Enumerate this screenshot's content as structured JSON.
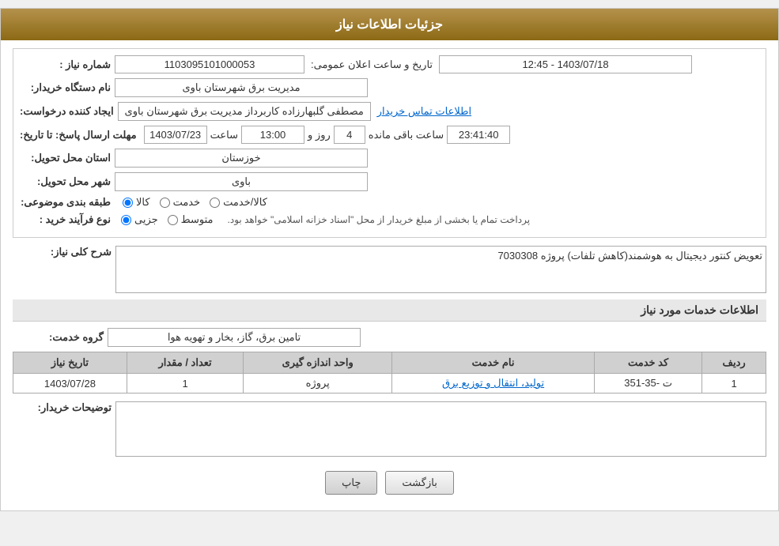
{
  "header": {
    "title": "جزئیات اطلاعات نیاز"
  },
  "fields": {
    "need_number_label": "شماره نیاز :",
    "need_number_value": "1103095101000053",
    "announce_date_label": "تاریخ و ساعت اعلان عمومی:",
    "announce_date_value": "1403/07/18 - 12:45",
    "buyer_org_label": "نام دستگاه خریدار:",
    "buyer_org_value": "مدیریت برق شهرستان باوی",
    "requester_label": "ایجاد کننده درخواست:",
    "requester_value": "مصطفی گلبهارزاده کاربرداز مدیریت برق شهرستان باوی",
    "contact_link": "اطلاعات تماس خریدار",
    "deadline_label": "مهلت ارسال پاسخ: تا تاریخ:",
    "deadline_date": "1403/07/23",
    "deadline_time_label": "ساعت",
    "deadline_time": "13:00",
    "deadline_days_label": "روز و",
    "deadline_days": "4",
    "deadline_remaining_label": "ساعت باقی مانده",
    "deadline_remaining": "23:41:40",
    "province_label": "استان محل تحویل:",
    "province_value": "خوزستان",
    "city_label": "شهر محل تحویل:",
    "city_value": "باوی",
    "category_label": "طبقه بندی موضوعی:",
    "category_goods": "کالا",
    "category_service": "خدمت",
    "category_goods_service": "کالا/خدمت",
    "purchase_type_label": "نوع فرآیند خرید :",
    "purchase_type_partial": "جزیی",
    "purchase_type_medium": "متوسط",
    "purchase_desc": "پرداخت تمام یا بخشی از مبلغ خریدار از محل \"اسناد خزانه اسلامی\" خواهد بود.",
    "need_desc_label": "شرح کلی نیاز:",
    "need_desc_value": "تعویض کنتور دیجیتال به هوشمند(کاهش تلفات) پروژه 7030308",
    "services_section_label": "اطلاعات خدمات مورد نیاز",
    "service_group_label": "گروه خدمت:",
    "service_group_value": "تامین برق، گاز، بخار و تهویه هوا"
  },
  "table": {
    "columns": [
      "ردیف",
      "کد خدمت",
      "نام خدمت",
      "واحد اندازه گیری",
      "تعداد / مقدار",
      "تاریخ نیاز"
    ],
    "rows": [
      {
        "row": "1",
        "code": "ت -35-351",
        "name": "تولید، انتقال و توزیع برق",
        "unit": "پروژه",
        "quantity": "1",
        "date": "1403/07/28"
      }
    ]
  },
  "buyer_comment_label": "توضیحات خریدار:",
  "buttons": {
    "print": "چاپ",
    "back": "بازگشت"
  }
}
